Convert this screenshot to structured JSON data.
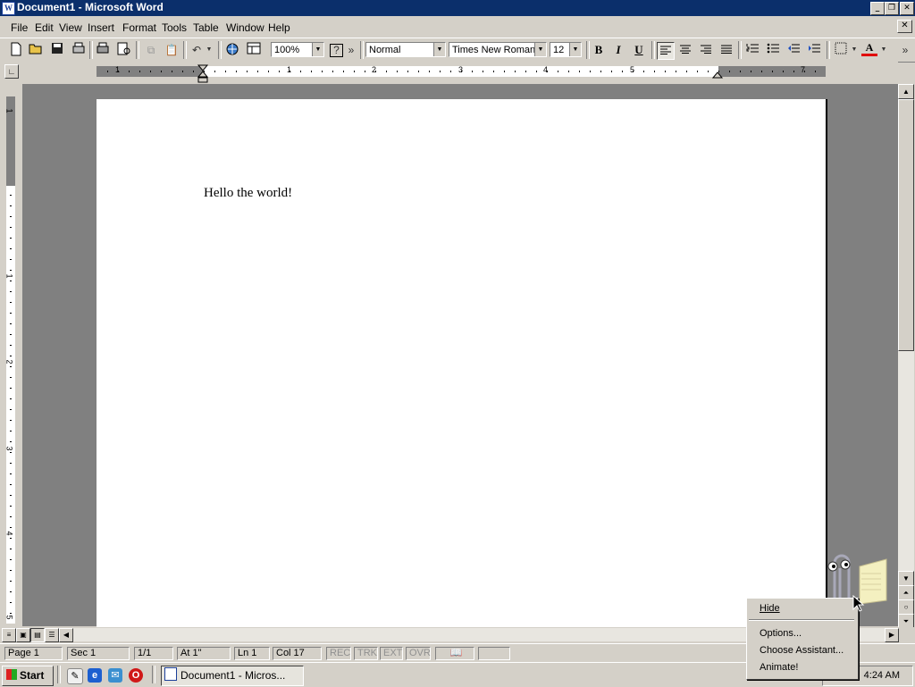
{
  "window": {
    "title": "Document1 - Microsoft Word",
    "app_icon_letter": "W"
  },
  "caption_buttons": [
    "_",
    "❐",
    "✕"
  ],
  "menubar": {
    "items": [
      "File",
      "Edit",
      "View",
      "Insert",
      "Format",
      "Tools",
      "Table",
      "Window",
      "Help"
    ],
    "close_label": "✕"
  },
  "toolbar": {
    "zoom": "100%",
    "style": "Normal",
    "font": "Times New Roman",
    "size": "12",
    "bold": "B",
    "italic": "I",
    "underline": "U",
    "help_glyph": "?",
    "more_glyph": "»"
  },
  "ruler": {
    "h_numbers": [
      "1",
      "1",
      "2",
      "3",
      "4",
      "5",
      "7"
    ],
    "v_numbers": [
      "1",
      "1",
      "2",
      "3",
      "4",
      "5"
    ]
  },
  "document": {
    "text": "Hello the world!"
  },
  "statusbar": {
    "page": "Page 1",
    "sec": "Sec 1",
    "pages": "1/1",
    "at": "At 1\"",
    "ln": "Ln 1",
    "col": "Col 17",
    "rec": "REC",
    "trk": "TRK",
    "ext": "EXT",
    "ovr": "OVR"
  },
  "taskbar": {
    "start": "Start",
    "task": "Document1 - Micros...",
    "clock": "4:24 AM"
  },
  "assistant_menu": {
    "items": [
      "Hide",
      "Options...",
      "Choose Assistant...",
      "Animate!"
    ]
  }
}
